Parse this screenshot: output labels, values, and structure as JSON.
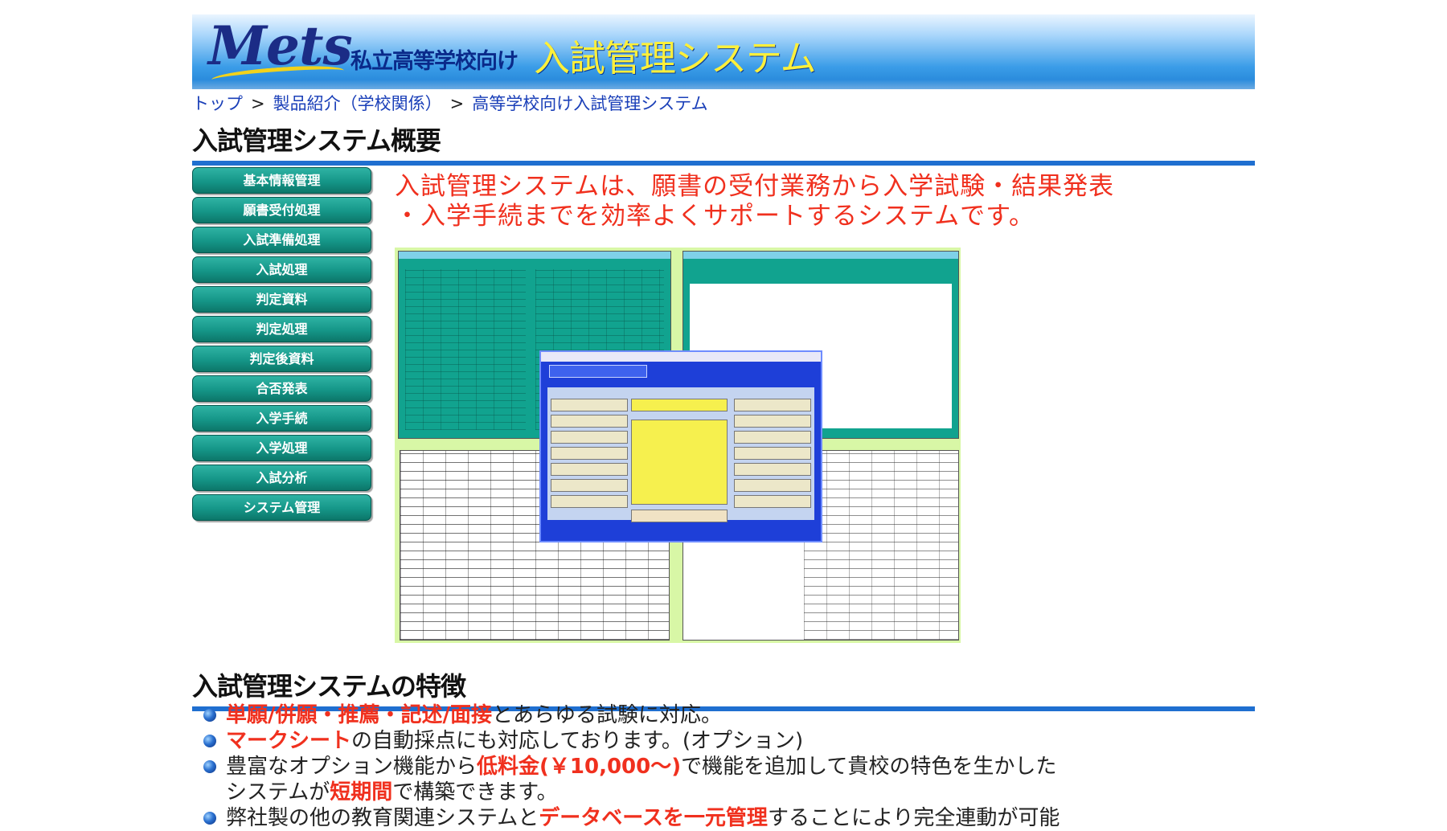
{
  "header": {
    "logo_text": "Mets",
    "tagline_small": "私立高等学校向け",
    "tagline_big": "入試管理システム"
  },
  "breadcrumb": [
    {
      "label": "トップ"
    },
    {
      "label": "製品紹介（学校関係）"
    },
    {
      "label": "高等学校向け入試管理システム"
    }
  ],
  "breadcrumb_sep": ">",
  "main": {
    "title": "入試管理システム概要",
    "intro_line1": "入試管理システムは、願書の受付業務から入学試験・結果発表",
    "intro_line2": "・入学手続までを効率よくサポートするシステムです。"
  },
  "sidebar": {
    "items": [
      {
        "label": "基本情報管理"
      },
      {
        "label": "願書受付処理"
      },
      {
        "label": "入試準備処理"
      },
      {
        "label": "入試処理"
      },
      {
        "label": "判定資料"
      },
      {
        "label": "判定処理"
      },
      {
        "label": "判定後資料"
      },
      {
        "label": "合否発表"
      },
      {
        "label": "入学手続"
      },
      {
        "label": "入学処理"
      },
      {
        "label": "入試分析"
      },
      {
        "label": "システム管理"
      }
    ]
  },
  "features": {
    "title": "入試管理システムの特徴",
    "items": [
      {
        "hl": "単願/併願・推薦・記述/面接",
        "text": "とあらゆる試験に対応。"
      },
      {
        "hl": "マークシート",
        "text": "の自動採点にも対応しております。(オプション)"
      },
      {
        "pre": "豊富なオプション機能から",
        "hl": "低料金(￥10,000～)",
        "text": "で機能を追加して貴校の特色を生かした",
        "line2_pre": "システムが",
        "line2_hl": "短期間",
        "line2_text": "で構築できます。"
      },
      {
        "pre": "弊社製の他の教育関連システムと",
        "hl": "データベースを一元管理",
        "text": "することにより完全連動が可能"
      }
    ]
  },
  "colors": {
    "accent_red": "#f0301e",
    "heading_rule": "#1f6fd0",
    "nav_teal": "#159688",
    "link_blue": "#1a3fb8"
  }
}
